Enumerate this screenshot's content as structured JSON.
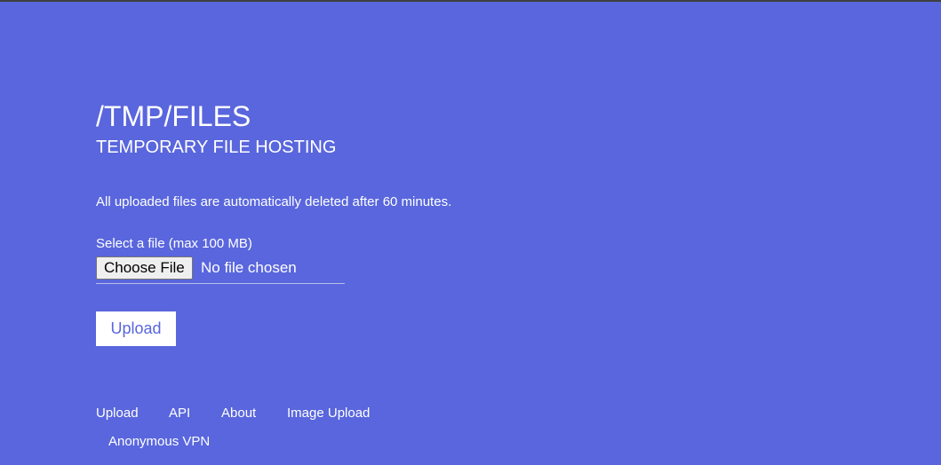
{
  "header": {
    "title": "/TMP/FILES",
    "subtitle": "TEMPORARY FILE HOSTING"
  },
  "main": {
    "notice": "All uploaded files are automatically deleted after 60 minutes.",
    "file_label": "Select a file (max 100 MB)",
    "choose_button_label": "Choose File",
    "file_status": "No file chosen",
    "upload_button_label": "Upload"
  },
  "footer": {
    "links": [
      {
        "label": "Upload"
      },
      {
        "label": "API"
      },
      {
        "label": "About"
      },
      {
        "label": "Image Upload"
      },
      {
        "label": "Anonymous VPN"
      }
    ]
  },
  "colors": {
    "background": "#5966dd",
    "text": "#ffffff",
    "upload_button_bg": "#ffffff",
    "upload_button_text": "#5966dd"
  }
}
